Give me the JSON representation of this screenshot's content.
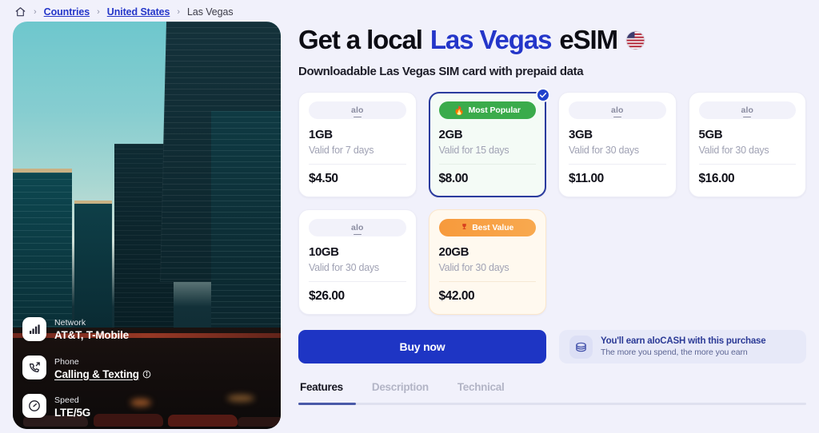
{
  "breadcrumb": {
    "home_icon": "home-icon",
    "separator": "›",
    "items": [
      {
        "label": "Countries",
        "link": true
      },
      {
        "label": "United States",
        "link": true
      },
      {
        "label": "Las Vegas",
        "link": false
      }
    ]
  },
  "hero": {
    "overlays": [
      {
        "icon": "signal-bars-icon",
        "label": "Network",
        "value": "AT&T, T-Mobile",
        "underlined": false,
        "info": false
      },
      {
        "icon": "phone-call-icon",
        "label": "Phone",
        "value": "Calling & Texting",
        "underlined": true,
        "info": true
      },
      {
        "icon": "speedometer-icon",
        "label": "Speed",
        "value": "LTE/5G",
        "underlined": false,
        "info": false
      }
    ]
  },
  "header": {
    "title_prefix": "Get a local",
    "title_accent": "Las Vegas",
    "title_suffix": "eSIM",
    "flag_icon": "us-flag-icon",
    "subtitle": "Downloadable Las Vegas SIM card with prepaid data"
  },
  "plans": [
    {
      "brand": "alo",
      "size": "1GB",
      "validity": "Valid for 7 days",
      "price": "$4.50",
      "badge": null,
      "selected": false,
      "style": "plain"
    },
    {
      "brand": "alo",
      "size": "2GB",
      "validity": "Valid for 15 days",
      "price": "$8.00",
      "badge": {
        "text": "Most Popular",
        "icon": "flame-icon",
        "style": "popular"
      },
      "selected": true,
      "style": "selected"
    },
    {
      "brand": "alo",
      "size": "3GB",
      "validity": "Valid for 30 days",
      "price": "$11.00",
      "badge": null,
      "selected": false,
      "style": "plain"
    },
    {
      "brand": "alo",
      "size": "5GB",
      "validity": "Valid for 30 days",
      "price": "$16.00",
      "badge": null,
      "selected": false,
      "style": "plain"
    },
    {
      "brand": "alo",
      "size": "10GB",
      "validity": "Valid for 30 days",
      "price": "$26.00",
      "badge": null,
      "selected": false,
      "style": "plain"
    },
    {
      "brand": "alo",
      "size": "20GB",
      "validity": "Valid for 30 days",
      "price": "$42.00",
      "badge": {
        "text": "Best Value",
        "icon": "trophy-icon",
        "style": "value"
      },
      "selected": false,
      "style": "best"
    }
  ],
  "cta": {
    "buy_label": "Buy now",
    "cash_icon": "coins-stack-icon",
    "cash_title": "You'll earn aloCASH with this purchase",
    "cash_subtitle": "The more you spend, the more you earn"
  },
  "tabs": {
    "items": [
      {
        "label": "Features",
        "active": true
      },
      {
        "label": "Description",
        "active": false
      },
      {
        "label": "Technical",
        "active": false
      }
    ]
  },
  "colors": {
    "accent_blue": "#2436c9",
    "buy_blue": "#1e35c4",
    "popular_green": "#3aab4b",
    "value_orange": "#f79a3c",
    "page_bg": "#f1f1fb"
  }
}
